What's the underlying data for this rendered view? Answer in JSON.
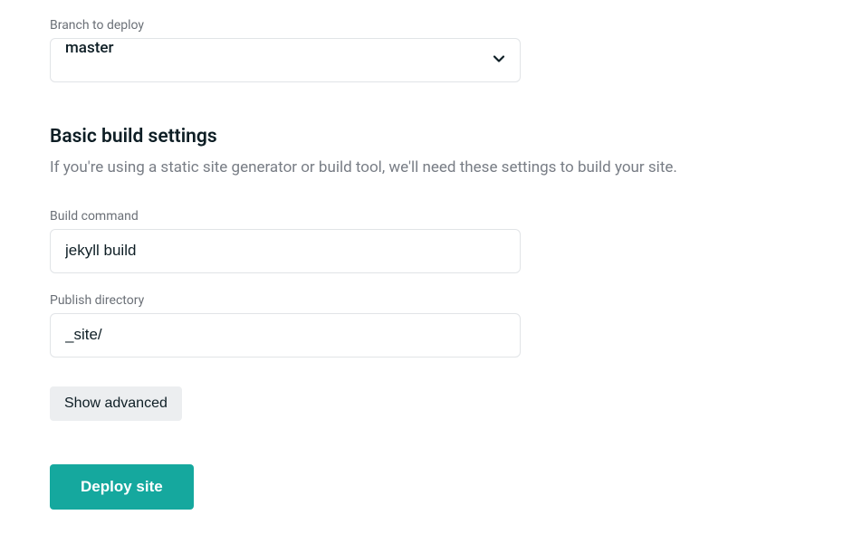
{
  "branch": {
    "label": "Branch to deploy",
    "value": "master"
  },
  "build_settings": {
    "title": "Basic build settings",
    "description": "If you're using a static site generator or build tool, we'll need these settings to build your site."
  },
  "build_command": {
    "label": "Build command",
    "value": "jekyll build"
  },
  "publish_directory": {
    "label": "Publish directory",
    "value": "_site/"
  },
  "buttons": {
    "show_advanced": "Show advanced",
    "deploy_site": "Deploy site"
  },
  "colors": {
    "primary": "#15a89e",
    "text_dark": "#0e1e25",
    "text_muted": "#787d85",
    "border": "#e1e4e7",
    "secondary_bg": "#eceef0"
  }
}
